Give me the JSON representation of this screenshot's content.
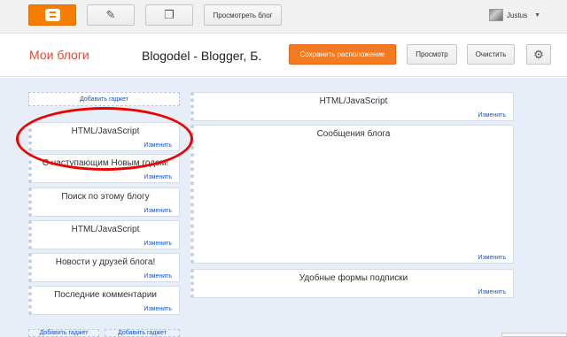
{
  "toolbar": {
    "view_blog_label": "Просмотреть блог",
    "user_name": "Justus"
  },
  "header": {
    "my_blogs": "Мои блоги",
    "blog_name": "Blogodel - Blogger, Б.",
    "save_label": "Сохранить расположение",
    "preview_label": "Просмотр",
    "clear_label": "Очистить"
  },
  "sidebar": {
    "add_gadget": "Добавить гаджет",
    "gadgets": [
      {
        "title": "HTML/JavaScript",
        "edit": "Изменить"
      },
      {
        "title": "С наступающим Новым годом!",
        "edit": "Изменить"
      },
      {
        "title": "Поиск по этому блогу",
        "edit": "Изменить"
      },
      {
        "title": "HTML/JavaScript",
        "edit": "Изменить"
      },
      {
        "title": "Новости у друзей блога!",
        "edit": "Изменить"
      },
      {
        "title": "Последние комментарии",
        "edit": "Изменить"
      }
    ]
  },
  "main": {
    "gadgets": [
      {
        "title": "HTML/JavaScript",
        "edit": "Изменить"
      },
      {
        "title": "Сообщения блога",
        "edit": "Изменить"
      },
      {
        "title": "Удобные формы подписки",
        "edit": "Изменить"
      }
    ]
  },
  "footer": {
    "add_gadget_1": "Добавить гаджет",
    "add_gadget_2": "Добавить гаджет"
  },
  "colors": {
    "brand_orange": "#f57d00",
    "save_button": "#f17a22",
    "title_red": "#dd4b39",
    "highlight_oval": "#ee0000",
    "link_blue": "#1155cc"
  }
}
